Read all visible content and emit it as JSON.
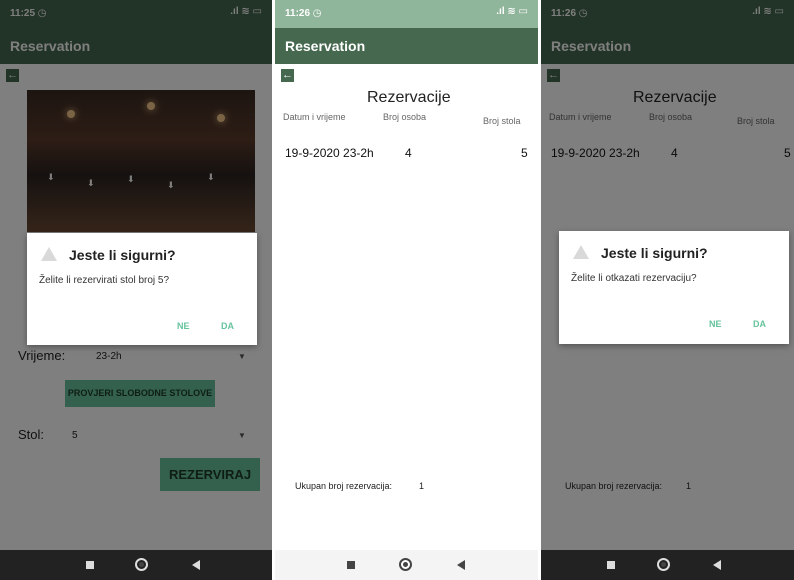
{
  "app": {
    "title": "Reservation"
  },
  "phone1": {
    "time": "11:25 ◷",
    "status_icons": ".ıl ≋ ▭",
    "vrijeme_label": "Vrijeme:",
    "vrijeme_value": "23-2h",
    "check_button": "PROVJERI SLOBODNE STOLOVE",
    "stol_label": "Stol:",
    "stol_value": "5",
    "reserve_button": "REZERVIRAJ",
    "dialog": {
      "title": "Jeste li sigurni?",
      "message": "Želite li rezervirati stol broj 5?",
      "no": "NE",
      "yes": "DA"
    }
  },
  "phone2": {
    "time": "11:26 ◷",
    "status_icons": ".ıl ≋ ▭",
    "heading": "Rezervacije",
    "columns": [
      "Datum i vrijeme",
      "Broj osoba",
      "Broj stola"
    ],
    "row": {
      "date": "19-9-2020 23-2h",
      "persons": "4",
      "table": "5"
    },
    "total_label": "Ukupan broj rezervacija:",
    "total_value": "1"
  },
  "phone3": {
    "time": "11:26 ◷",
    "status_icons": ".ıl ≋ ▭",
    "heading": "Rezervacije",
    "columns": [
      "Datum i vrijeme",
      "Broj osoba",
      "Broj stola"
    ],
    "row": {
      "date": "19-9-2020 23-2h",
      "persons": "4",
      "table": "5"
    },
    "total_label": "Ukupan broj rezervacija:",
    "total_value": "1",
    "dialog": {
      "title": "Jeste li sigurni?",
      "message": "Želite li otkazati rezervaciju?",
      "no": "NE",
      "yes": "DA"
    }
  },
  "icons": {
    "back": "arrow-left-icon",
    "warning": "warning-icon",
    "dropdown": "chevron-down-icon",
    "nav_recents": "square-icon",
    "nav_home": "circle-icon",
    "nav_back": "triangle-back-icon"
  },
  "colors": {
    "primary": "#45684f",
    "accent": "#66c39c"
  }
}
